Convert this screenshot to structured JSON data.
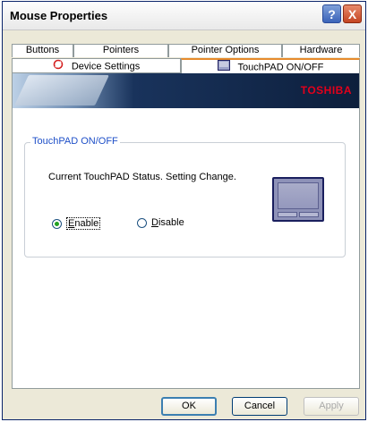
{
  "window": {
    "title": "Mouse Properties"
  },
  "titlebar": {
    "help_glyph": "?",
    "close_glyph": "X"
  },
  "tabs": {
    "row1": [
      {
        "label": "Buttons"
      },
      {
        "label": "Pointers"
      },
      {
        "label": "Pointer Options"
      },
      {
        "label": "Hardware"
      }
    ],
    "row2": [
      {
        "label": "Device Settings",
        "icon": "synaptics-icon"
      },
      {
        "label": "TouchPAD ON/OFF",
        "icon": "touchpad-icon",
        "active": true
      }
    ]
  },
  "banner": {
    "brand": "TOSHIBA"
  },
  "group": {
    "legend": "TouchPAD ON/OFF",
    "status_text": "Current TouchPAD Status. Setting Change.",
    "enable": {
      "mnemonic": "E",
      "rest": "nable",
      "checked": true
    },
    "disable": {
      "mnemonic": "D",
      "rest": "isable",
      "checked": false
    }
  },
  "buttons": {
    "ok": "OK",
    "cancel": "Cancel",
    "apply": "Apply"
  },
  "colors": {
    "title_text": "#000000",
    "active_tab_accent": "#e68b2c",
    "legend": "#1f50c8",
    "brand": "#e3001b"
  }
}
